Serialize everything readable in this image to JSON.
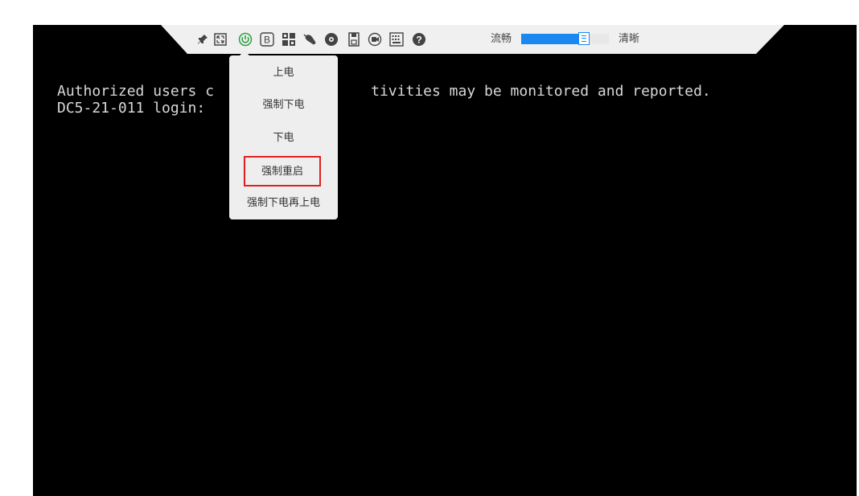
{
  "console": {
    "lines": [
      "Authorized users c                  tivities may be monitored and reported.",
      "DC5-21-011 login: "
    ],
    "background": "#000000",
    "text_color": "#d8d8d8"
  },
  "toolbar": {
    "icons": [
      {
        "name": "pin-icon",
        "title": "pin"
      },
      {
        "name": "fullscreen-icon",
        "title": "fullscreen"
      },
      {
        "name": "power-icon",
        "title": "power",
        "color": "#2ea043"
      },
      {
        "name": "boot-option-icon",
        "label": "B"
      },
      {
        "name": "keyboard-combo-icon",
        "title": "key combination"
      },
      {
        "name": "mouse-icon",
        "title": "mouse"
      },
      {
        "name": "record-icon",
        "title": "disc"
      },
      {
        "name": "floppy-icon",
        "title": "virtual media"
      },
      {
        "name": "video-record-icon",
        "title": "record video"
      },
      {
        "name": "virtual-keyboard-icon",
        "title": "keyboard"
      },
      {
        "name": "help-icon",
        "label": "?"
      }
    ],
    "quality": {
      "left_label": "流畅",
      "right_label": "清晰",
      "level_fraction": 0.72,
      "accent": "#1a88f0"
    }
  },
  "power_menu": {
    "items": [
      {
        "label": "上电"
      },
      {
        "label": "强制下电"
      },
      {
        "label": "下电"
      },
      {
        "label": "强制重启",
        "highlighted": true,
        "highlight_color": "#e02020"
      },
      {
        "label": "强制下电再上电"
      }
    ]
  }
}
